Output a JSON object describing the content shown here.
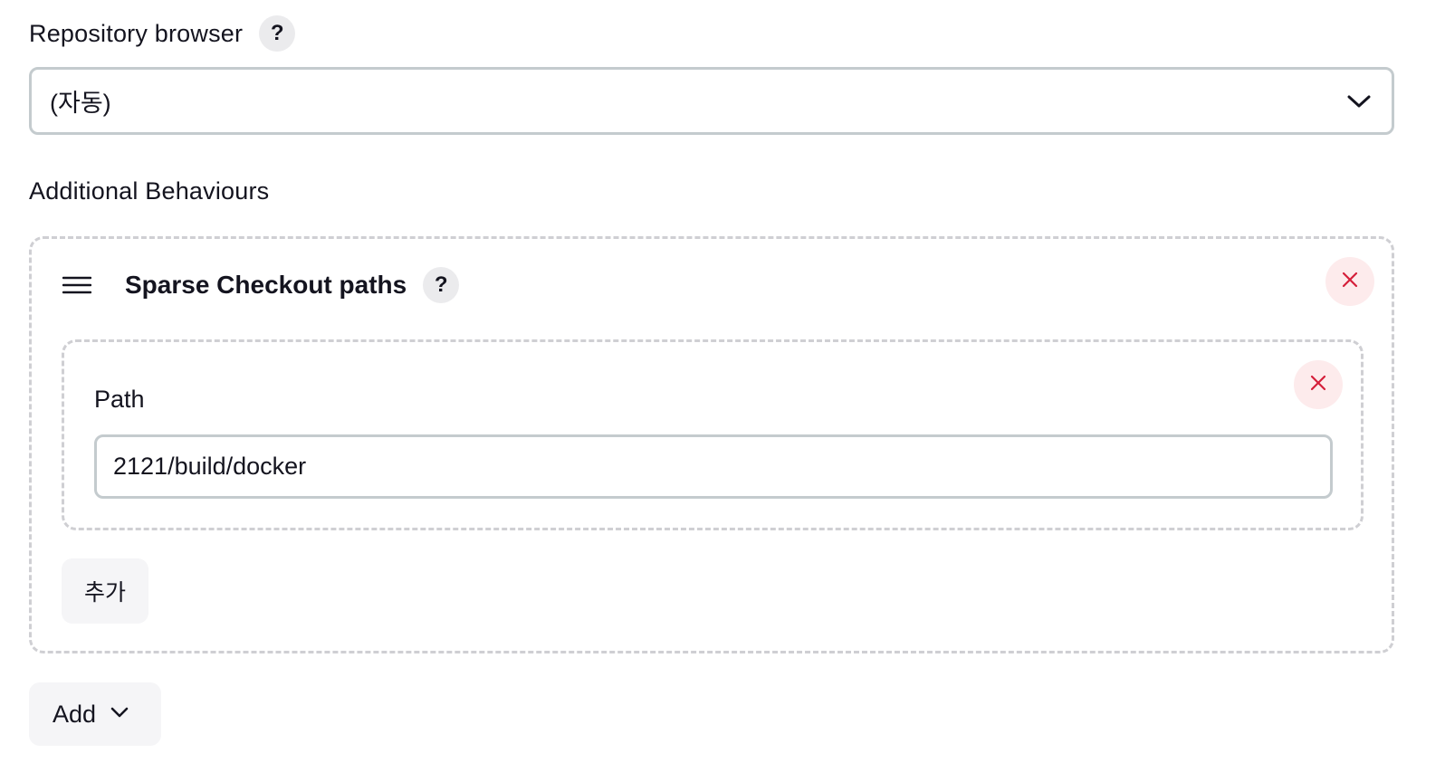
{
  "repository_browser": {
    "label": "Repository browser",
    "help_icon": "?",
    "selected_value": "(자동)",
    "chevron_icon": "chevron-down-icon"
  },
  "additional_behaviours": {
    "label": "Additional Behaviours",
    "behaviour": {
      "title": "Sparse Checkout paths",
      "help_icon": "?",
      "drag_icon": "hamburger-icon",
      "delete_icon": "close-icon",
      "path_entry": {
        "label": "Path",
        "value": "2121/build/docker",
        "delete_icon": "close-icon"
      },
      "add_path_label": "추가"
    },
    "add_button_label": "Add",
    "add_chevron_icon": "chevron-down-icon"
  },
  "colors": {
    "delete_accent": "#d51f3a",
    "delete_bg": "#fdebec",
    "border": "#c4cbce",
    "dashed_border": "#cfcfd3",
    "button_bg": "#f5f5f7"
  }
}
